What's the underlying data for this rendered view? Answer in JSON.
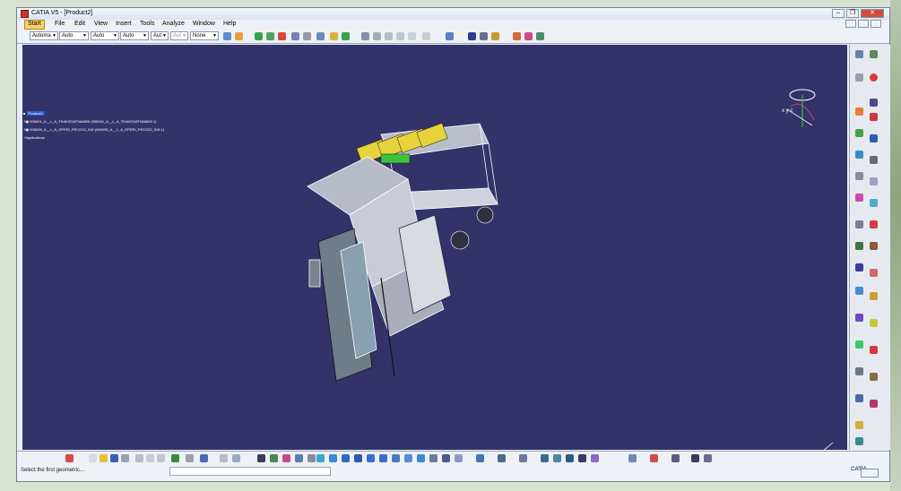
{
  "window": {
    "title": "CATIA V5 - [Product2]",
    "minimize": "–",
    "restore": "❐",
    "close": "✕"
  },
  "menu": [
    "Start",
    "File",
    "Edit",
    "View",
    "Insert",
    "Tools",
    "Analyze",
    "Window",
    "Help"
  ],
  "toolbar": {
    "combos": [
      "Automa",
      "Auto",
      "Auto",
      "Auto",
      "Aut",
      "Aut",
      "None"
    ]
  },
  "tree": {
    "root": "Product2",
    "children": [
      "906001_A__L_A_TKAKSOATVA6826 (906001_A__L_A_TKAKSOATVA6826.1)",
      "906005_A__L_A_OPERI_PECO22_018 (906005_A__L_A_OPERI_PECO22_018.1)",
      "Applications"
    ]
  },
  "compass": {
    "label": "x y z"
  },
  "axis_label": "x y z",
  "catia_logo": "CATIA",
  "status": {
    "text": "Select the first geometric..."
  },
  "colors": {
    "viewport_bg": "#33336a",
    "titlebar": "#dfe8f3"
  }
}
